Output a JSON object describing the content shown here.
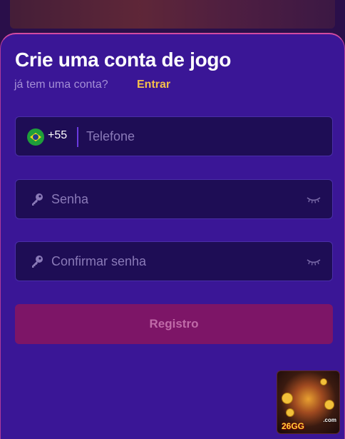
{
  "header": {
    "title": "Crie uma conta de jogo",
    "subtitle": "já tem uma conta?",
    "login_link": "Entrar"
  },
  "form": {
    "phone": {
      "country_code": "+55",
      "placeholder": "Telefone",
      "value": "",
      "flag": "brazil-flag-icon"
    },
    "password": {
      "placeholder": "Senha",
      "value": "",
      "icon": "key-icon",
      "toggle_icon": "eye-closed-icon"
    },
    "confirm_password": {
      "placeholder": "Confirmar senha",
      "value": "",
      "icon": "key-icon",
      "toggle_icon": "eye-closed-icon"
    },
    "submit_label": "Registro"
  },
  "promo": {
    "brand": "26GG",
    "domain": ".com"
  },
  "colors": {
    "panel_bg": "#3a1696",
    "field_bg": "#1e0d55",
    "accent_link": "#f5c04a",
    "button_bg": "#7d1567",
    "button_text": "#c06aa8"
  }
}
